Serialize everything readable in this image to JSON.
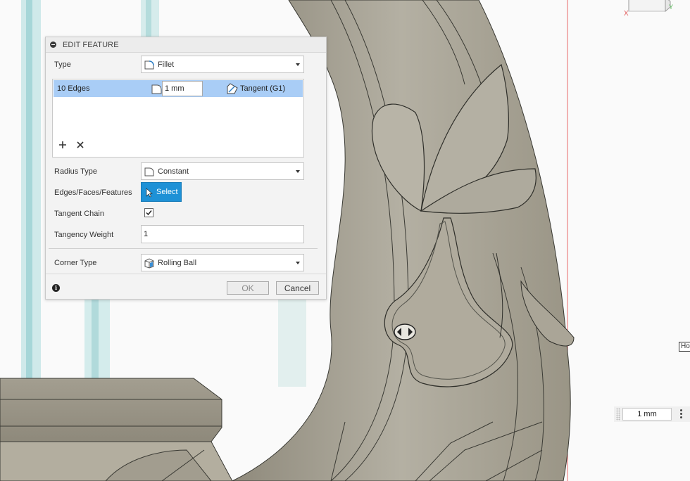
{
  "dialog": {
    "title": "EDIT FEATURE",
    "type_label": "Type",
    "type_value": "Fillet",
    "edges": {
      "name": "10 Edges",
      "radius": "1 mm",
      "continuity": "Tangent (G1)"
    },
    "radius_type_label": "Radius Type",
    "radius_type_value": "Constant",
    "edges_faces_label": "Edges/Faces/Features",
    "select_label": "Select",
    "tangent_chain_label": "Tangent Chain",
    "tangent_chain_checked": true,
    "tangency_weight_label": "Tangency Weight",
    "tangency_weight_value": "1",
    "corner_type_label": "Corner Type",
    "corner_type_value": "Rolling Ball",
    "ok_label": "OK",
    "cancel_label": "Cancel"
  },
  "viewport": {
    "hover_label": "Ho",
    "value_input": "1 mm",
    "axis_label_x": "X",
    "axis_label_y": "Y"
  },
  "colors": {
    "accent": "#1e91d6",
    "selection": "#a9cdf6",
    "model": "#a8a394"
  }
}
